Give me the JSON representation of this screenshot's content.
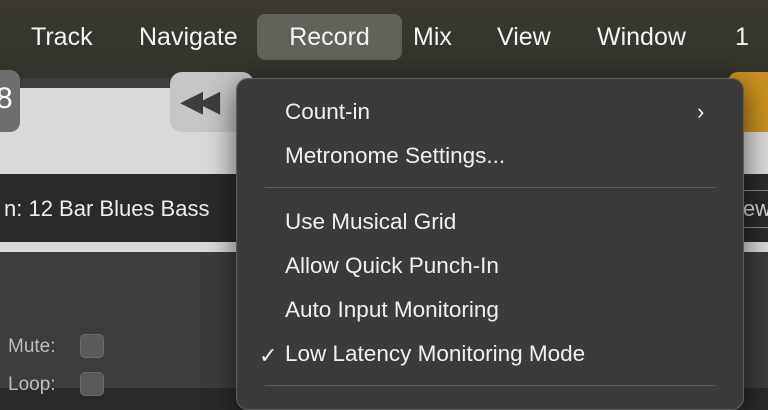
{
  "menubar": {
    "items": [
      {
        "label": "Track"
      },
      {
        "label": "Navigate"
      },
      {
        "label": "Record",
        "active": true
      },
      {
        "label": "Mix"
      },
      {
        "label": "View"
      },
      {
        "label": "Window"
      },
      {
        "label": "1"
      }
    ]
  },
  "record_menu": {
    "count_in": "Count-in",
    "metronome_settings": "Metronome Settings...",
    "use_musical_grid": "Use Musical Grid",
    "allow_quick_punch_in": "Allow Quick Punch-In",
    "auto_input_monitoring": "Auto Input Monitoring",
    "low_latency_mode": "Low Latency Monitoring Mode",
    "low_latency_checked": true,
    "submenu_arrow": "›",
    "checkmark": "✓"
  },
  "app": {
    "track_name": "n: 12 Bar Blues Bass",
    "right_label": "iew",
    "mute_label": "Mute:",
    "loop_label": "Loop:",
    "rewind_icon": "rewind-icon",
    "left_icon": "tool-icon"
  },
  "colors": {
    "menubar_bg": "#36352e",
    "active_menu_bg": "#62625b",
    "menu_bg": "#3b3b3b",
    "accent_orange": "#c8901f"
  }
}
